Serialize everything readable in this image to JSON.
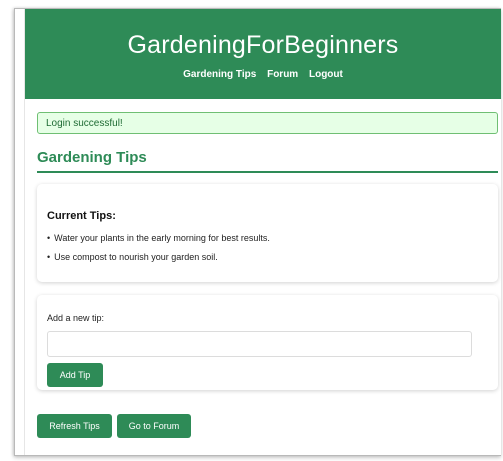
{
  "header": {
    "site_title": "GardeningForBeginners",
    "nav": [
      {
        "label": "Gardening Tips"
      },
      {
        "label": "Forum"
      },
      {
        "label": "Logout"
      }
    ]
  },
  "alert": {
    "message": "Login successful!"
  },
  "main": {
    "section_title": "Gardening Tips",
    "tips_card": {
      "heading": "Current Tips:",
      "tips": [
        "Water your plants in the early morning for best results.",
        "Use compost to nourish your garden soil."
      ]
    },
    "form_card": {
      "label": "Add a new tip:",
      "input_value": "",
      "input_placeholder": "",
      "add_button_label": "Add Tip"
    },
    "actions": {
      "refresh_label": "Refresh Tips",
      "forum_label": "Go to Forum"
    }
  },
  "colors": {
    "brand_green": "#2e8b57",
    "alert_background": "#e6ffe6",
    "alert_border": "#6fbf73"
  }
}
